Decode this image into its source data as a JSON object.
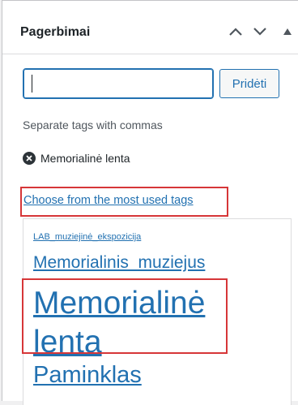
{
  "panel": {
    "title": "Pagerbimai"
  },
  "tag_input": {
    "value": "",
    "add_button_label": "Pridėti"
  },
  "hint": "Separate tags with commas",
  "current_tags": [
    {
      "label": "Memorialinė lenta"
    }
  ],
  "choose_link": "Choose from the most used tags",
  "tag_cloud": [
    {
      "label": "LAB_muziejinė_ekspozicija"
    },
    {
      "label": "Memorialinis_muziejus"
    },
    {
      "label": "Memorialinė lenta"
    },
    {
      "label": "Paminklas"
    }
  ],
  "colors": {
    "accent": "#2271b1",
    "highlight": "#d63638"
  }
}
